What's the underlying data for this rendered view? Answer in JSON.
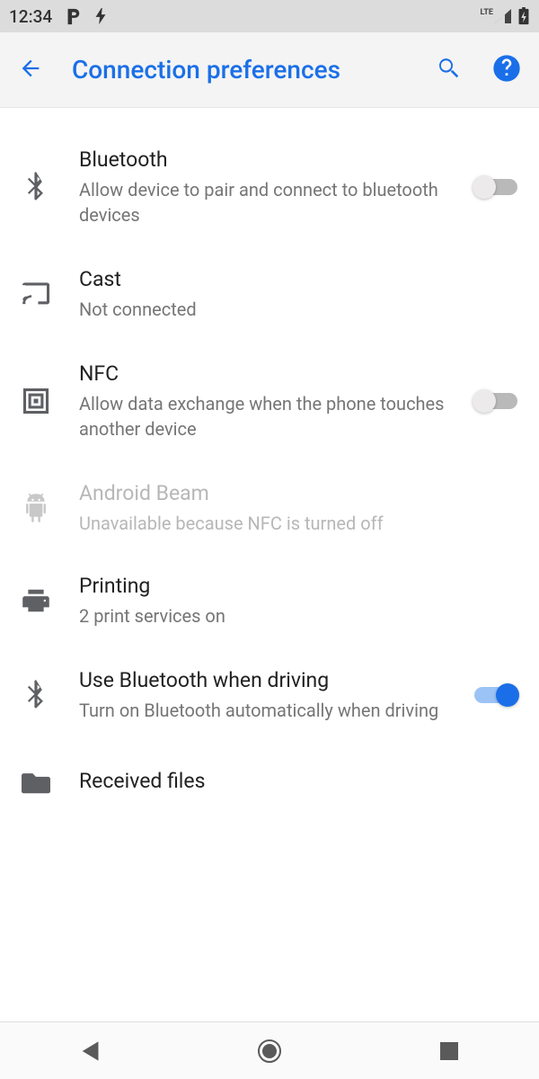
{
  "status": {
    "time": "12:34",
    "lte_label": "LTE"
  },
  "appbar": {
    "title": "Connection preferences"
  },
  "settings": {
    "bluetooth": {
      "title": "Bluetooth",
      "subtitle": "Allow device to pair and connect to bluetooth devices",
      "toggled": false
    },
    "cast": {
      "title": "Cast",
      "subtitle": "Not connected"
    },
    "nfc": {
      "title": "NFC",
      "subtitle": "Allow data exchange when the phone touches another device",
      "toggled": false
    },
    "beam": {
      "title": "Android Beam",
      "subtitle": "Unavailable because NFC is turned off"
    },
    "printing": {
      "title": "Printing",
      "subtitle": "2 print services on"
    },
    "bt_driving": {
      "title": "Use Bluetooth when driving",
      "subtitle": "Turn on Bluetooth automatically when driving",
      "toggled": true
    },
    "received": {
      "title": "Received files"
    }
  },
  "colors": {
    "accent": "#1a6fe8"
  }
}
